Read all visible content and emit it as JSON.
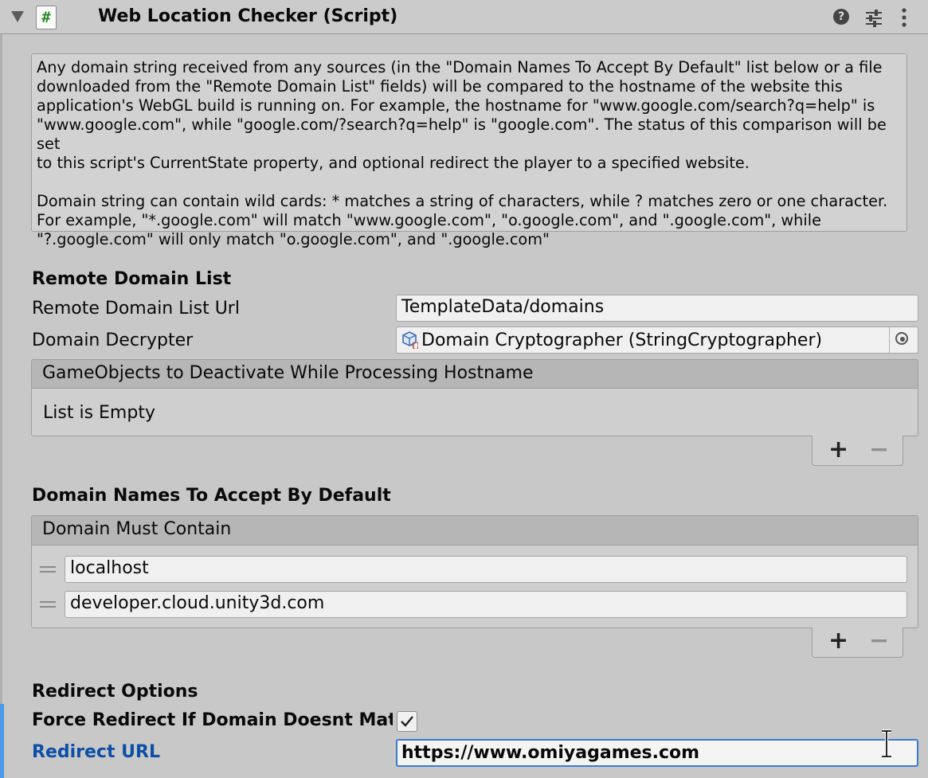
{
  "header": {
    "title": "Web Location Checker (Script)",
    "script_icon_glyph": "#",
    "help_glyph": "?",
    "icons": [
      "foldout-arrow-icon",
      "script-icon",
      "help-icon",
      "presets-icon",
      "context-menu-icon"
    ]
  },
  "help_box": {
    "paragraph1": "Any domain string received from any sources (in the \"Domain Names To Accept By Default\" list below or a file\ndownloaded from the \"Remote Domain List\" fields) will be compared to the hostname of the website this\napplication's WebGL build is running on. For example, the hostname for \"www.google.com/search?q=help\" is\n\"www.google.com\", while \"google.com/?search?q=help\" is \"google.com\". The status of this comparison will be set\nto this script's CurrentState property, and optional redirect the player to a specified website.",
    "paragraph2": "Domain string can contain wild cards: * matches a string of characters, while ? matches zero or one character.\nFor example, \"*.google.com\" will match \"www.google.com\", \"o.google.com\", and \".google.com\", while\n\"?.google.com\" will only match \"o.google.com\", and \".google.com\""
  },
  "remote_domain_list": {
    "section_title": "Remote Domain List",
    "url_label": "Remote Domain List Url",
    "url_value": "TemplateData/domains",
    "decrypter_label": "Domain Decrypter",
    "decrypter_value": "Domain Cryptographer (StringCryptographer)",
    "deactivate_list": {
      "header": "GameObjects to Deactivate While Processing Hostname",
      "empty_text": "List is Empty",
      "add_glyph": "+",
      "remove_glyph": "−"
    }
  },
  "domain_names": {
    "section_title": "Domain Names To Accept By Default",
    "list_header": "Domain Must Contain",
    "items": [
      "localhost",
      "developer.cloud.unity3d.com"
    ],
    "add_glyph": "+",
    "remove_glyph": "−"
  },
  "redirect": {
    "section_title": "Redirect Options",
    "force_label": "Force Redirect If Domain Doesnt Match",
    "force_checked": true,
    "url_label": "Redirect URL",
    "url_value": "https://www.omiyagames.com"
  },
  "colors": {
    "background": "#c8c8c8",
    "focus_accent": "#4b9be8",
    "label_focus": "#0d4fa8",
    "script_icon_green": "#2e8b2e"
  }
}
